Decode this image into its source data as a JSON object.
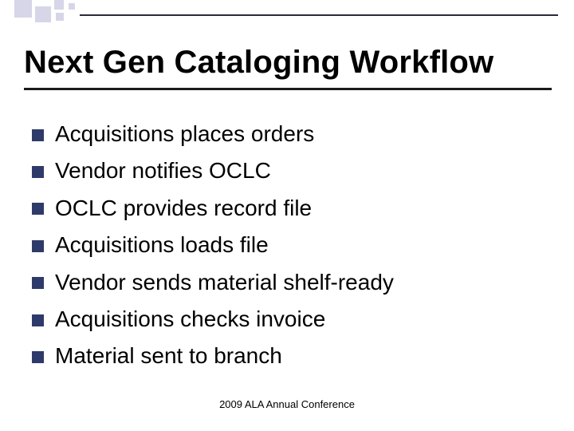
{
  "slide": {
    "title": "Next Gen Cataloging Workflow",
    "bullets": [
      "Acquisitions places orders",
      "Vendor notifies OCLC",
      "OCLC provides record file",
      "Acquisitions loads file",
      "Vendor sends material shelf-ready",
      "Acquisitions checks invoice",
      "Material sent to branch"
    ],
    "footer": "2009 ALA Annual Conference"
  },
  "colors": {
    "bullet_square": "#2e3a6a",
    "accent_dark": "#3a4a8a",
    "accent_light": "#c0c8e8"
  }
}
